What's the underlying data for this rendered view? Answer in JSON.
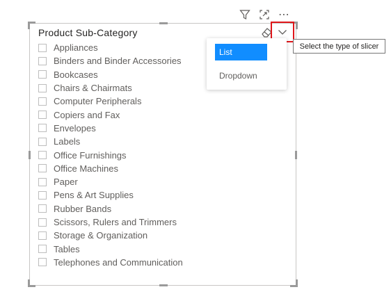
{
  "toolbar": {
    "icons": [
      "filter-icon",
      "focus-mode-icon",
      "more-options-icon"
    ],
    "more_options": "⋯"
  },
  "slicer": {
    "title": "Product Sub-Category",
    "items": [
      "Appliances",
      "Binders and Binder Accessories",
      "Bookcases",
      "Chairs & Chairmats",
      "Computer Peripherals",
      "Copiers and Fax",
      "Envelopes",
      "Labels",
      "Office Furnishings",
      "Office Machines",
      "Paper",
      "Pens & Art Supplies",
      "Rubber Bands",
      "Scissors, Rulers and Trimmers",
      "Storage & Organization",
      "Tables",
      "Telephones and Communication"
    ]
  },
  "slicer_type_menu": {
    "options": [
      "List",
      "Dropdown"
    ],
    "selected": "List"
  },
  "tooltip": "Select the type of slicer",
  "colors": {
    "accent": "#118dff",
    "highlight_border": "#e0161a",
    "text": "#605e5c"
  }
}
